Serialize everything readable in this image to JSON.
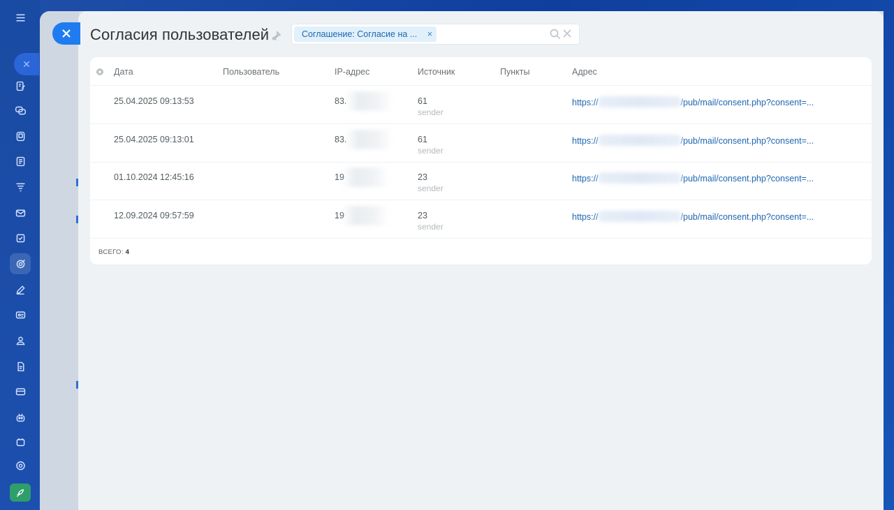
{
  "title": "Согласия пользователей",
  "filter": {
    "chip_label": "Соглашение: Согласие на ...",
    "chip_remove": "×"
  },
  "columns": {
    "date": "Дата",
    "user": "Пользователь",
    "ip": "IP-адрес",
    "source": "Источник",
    "items": "Пункты",
    "url": "Адрес"
  },
  "rows": [
    {
      "date": "25.04.2025 09:13:53",
      "ip": "83.",
      "source": "61",
      "source_sub": "sender",
      "url_prefix": "https://",
      "url_suffix": "/pub/mail/consent.php?consent=..."
    },
    {
      "date": "25.04.2025 09:13:01",
      "ip": "83.",
      "source": "61",
      "source_sub": "sender",
      "url_prefix": "https://",
      "url_suffix": "/pub/mail/consent.php?consent=..."
    },
    {
      "date": "01.10.2024 12:45:16",
      "ip": "19",
      "source": "23",
      "source_sub": "sender",
      "url_prefix": "https://",
      "url_suffix": "/pub/mail/consent.php?consent=..."
    },
    {
      "date": "12.09.2024 09:57:59",
      "ip": "19",
      "source": "23",
      "source_sub": "sender",
      "url_prefix": "https://",
      "url_suffix": "/pub/mail/consent.php?consent=..."
    }
  ],
  "footer": {
    "total_label": "ВСЕГО:",
    "total_value": "4"
  },
  "colors": {
    "accent": "#1e7cf0",
    "link": "#2067b0",
    "chip_bg": "#e1f1fb"
  }
}
